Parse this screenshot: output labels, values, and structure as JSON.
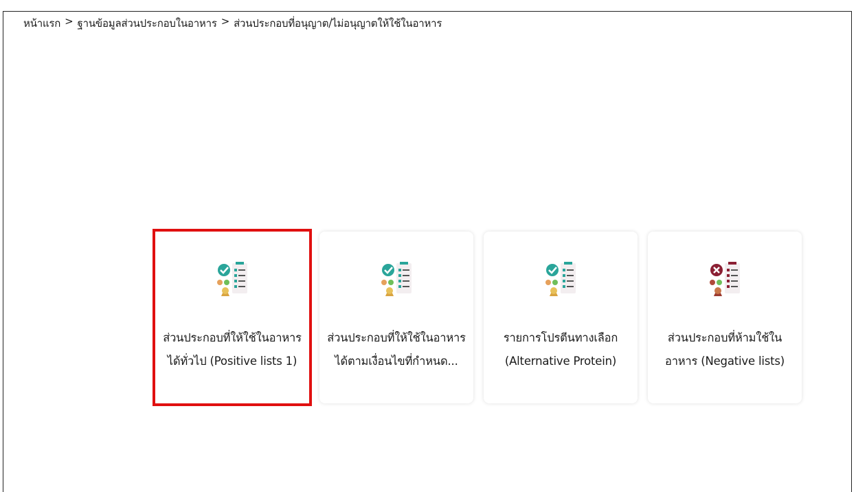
{
  "breadcrumb": {
    "items": [
      "หน้าแรก",
      "ฐานข้อมูลส่วนประกอบในอาหาร",
      "ส่วนประกอบที่อนุญาต/ไม่อนุญาตให้ใช้ในอาหาร"
    ],
    "separator": ">"
  },
  "cards": [
    {
      "line1": "ส่วนประกอบที่ให้ใช้ในอาหาร",
      "line2": "ได้ทั่วไป (Positive lists 1)",
      "icon": "checklist-approved-icon",
      "accent": "#2aa59a",
      "selected": true
    },
    {
      "line1": "ส่วนประกอบที่ให้ใช้ในอาหาร",
      "line2": "ได้ตามเงื่อนไขที่กำหนด...",
      "icon": "checklist-approved-icon",
      "accent": "#2aa59a",
      "selected": false
    },
    {
      "line1": "รายการโปรตีนทางเลือก",
      "line2": "(Alternative Protein)",
      "icon": "checklist-approved-icon",
      "accent": "#2aa59a",
      "selected": false
    },
    {
      "line1": "ส่วนประกอบที่ห้ามใช้ใน",
      "line2": "อาหาร (Negative lists)",
      "icon": "checklist-rejected-icon",
      "accent": "#8b1f33",
      "selected": false
    }
  ],
  "colors": {
    "selection": "#e01010",
    "approve": "#2aa59a",
    "reject": "#8b1f33"
  }
}
